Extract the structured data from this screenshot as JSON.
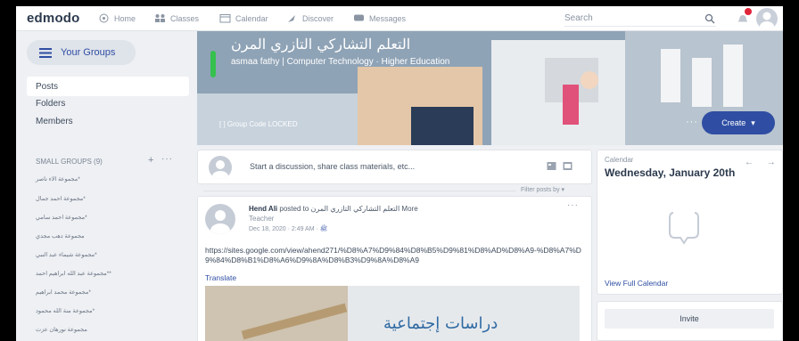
{
  "nav": {
    "logo": "edmodo",
    "items": [
      "Home",
      "Classes",
      "Calendar",
      "Discover",
      "Messages"
    ],
    "search_placeholder": "Search"
  },
  "sidebar": {
    "your_groups": "Your Groups",
    "items": [
      "Posts",
      "Folders",
      "Members"
    ],
    "small_groups_label": "SMALL GROUPS (9)",
    "small_groups": [
      "*مجموعة الاء ناصر",
      "*مجموعة احمد جمال",
      "*مجموعة احمد سامي",
      "مجموعة دهب مجدي",
      "*مجموعة شيماء عبد النبي",
      "**مجموعة عبد الله ابراهيم احمد",
      "*مجموعة محمد ابراهيم",
      "*مجموعة منة الله محمود",
      "مجموعة نورهان عزت"
    ]
  },
  "banner": {
    "title": "التعلم التشاركي التازري المرن",
    "subtitle": "asmaa fathy | Computer Technology · Higher Education",
    "group_code": "Group Code LOCKED",
    "create_label": "Create",
    "accent": "#36c14f",
    "brand": "#2f4ea3"
  },
  "compose": {
    "placeholder": "Start a discussion, share class materials, etc..."
  },
  "filter": "Filter posts by",
  "post": {
    "author": "Hend Ali",
    "posted_to_prefix": "posted to",
    "group": "التعلم التشاركي التازري المرن",
    "more": "More",
    "role": "Teacher",
    "date": "Dec 18, 2020 · 2:49 AM ·",
    "link": "https://sites.google.com/view/ahend271/%D8%A7%D9%84%D8%B5%D9%81%D8%AD%D8%A9-%D8%A7%D9%84%D8%B1%D8%A6%D9%8A%D8%B3%D9%8A%D8%A9",
    "translate": "Translate",
    "image_text": "دراسات إجتماعية"
  },
  "calendar": {
    "label": "Calendar",
    "date": "Wednesday, January 20th",
    "arrows": "← →",
    "view_full": "View Full Calendar"
  },
  "invite": {
    "label": "Invite"
  }
}
